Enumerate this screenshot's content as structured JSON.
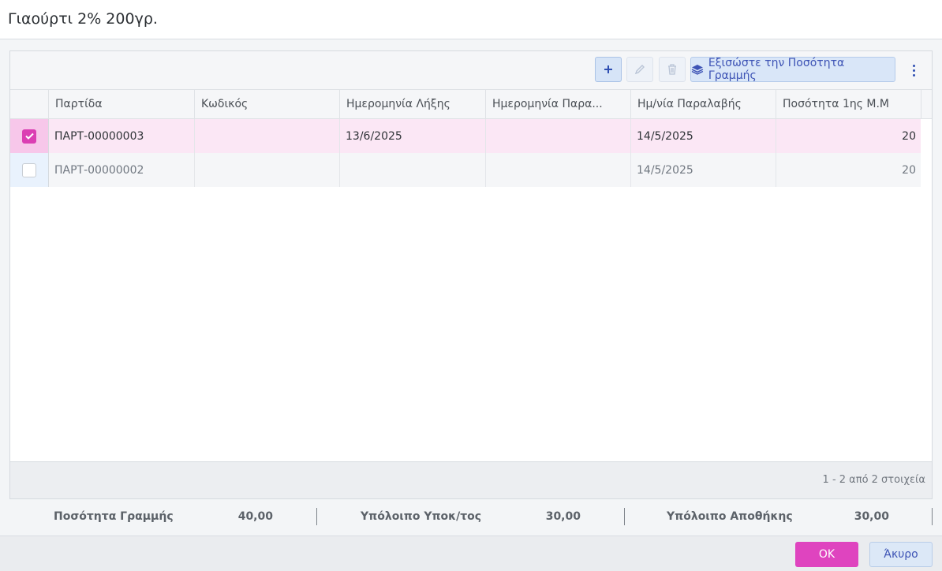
{
  "dialog": {
    "title": "Γιαούρτι 2% 200γρ."
  },
  "toolbar": {
    "add_icon": "plus-icon",
    "edit_icon": "pencil-icon",
    "delete_icon": "trash-icon",
    "equalize_icon": "layers-icon",
    "equalize_label": "Εξισώστε την Ποσότητα Γραμμής",
    "more_icon": "kebab-icon"
  },
  "table": {
    "columns": [
      "Παρτίδα",
      "Κωδικός",
      "Ημερομηνία Λήξης",
      "Ημερομηνία Παρα...",
      "Ημ/νία Παραλαβής",
      "Ποσότητα 1ης Μ.Μ"
    ],
    "rows": [
      {
        "selected": true,
        "cells": [
          "ΠΑΡΤ-00000003",
          "",
          "13/6/2025",
          "",
          "14/5/2025",
          "20"
        ]
      },
      {
        "selected": false,
        "cells": [
          "ΠΑΡΤ-00000002",
          "",
          "",
          "",
          "14/5/2025",
          "20"
        ]
      }
    ],
    "pager": "1 - 2 από 2 στοιχεία"
  },
  "summary": {
    "line_qty_label": "Ποσότητα Γραμμής",
    "line_qty_value": "40,00",
    "sub_remaining_label": "Υπόλοιπο Υποκ/τος",
    "sub_remaining_value": "30,00",
    "warehouse_remaining_label": "Υπόλοιπο Αποθήκης",
    "warehouse_remaining_value": "30,00"
  },
  "footer": {
    "ok_label": "ΟΚ",
    "cancel_label": "Άκυρο"
  },
  "colors": {
    "accent": "#df44bf",
    "selected_row": "#fbe7f5",
    "primary_blue": "#3d53b5"
  }
}
